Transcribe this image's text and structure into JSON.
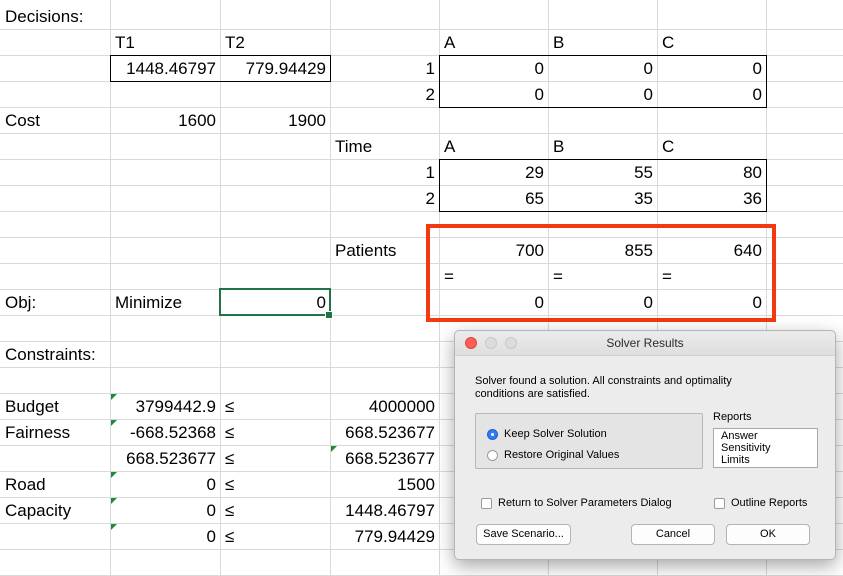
{
  "sheet": {
    "decisions_label": "Decisions:",
    "col_T1": "T1",
    "col_T2": "T2",
    "t1_value": "1448.46797",
    "t2_value": "779.94429",
    "grid_header": {
      "A": "A",
      "B": "B",
      "C": "C"
    },
    "row1": "1",
    "row2": "2",
    "dec_row1": [
      "0",
      "0",
      "0"
    ],
    "dec_row2": [
      "0",
      "0",
      "0"
    ],
    "cost_label": "Cost",
    "cost_t1": "1600",
    "cost_t2": "1900",
    "time_label": "Time",
    "time_row1": [
      "29",
      "55",
      "80"
    ],
    "time_row2": [
      "65",
      "35",
      "36"
    ],
    "patients_label": "Patients",
    "patients": [
      "700",
      "855",
      "640"
    ],
    "equals": [
      "=",
      "=",
      "="
    ],
    "patients_result": [
      "0",
      "0",
      "0"
    ],
    "obj_label": "Obj:",
    "minimize_label": "Minimize",
    "obj_value": "0",
    "constraints_label": "Constraints:",
    "constraints": [
      {
        "name": "Budget",
        "lhs": "3799442.9",
        "op": "≤",
        "rhs": "4000000"
      },
      {
        "name": "Fairness",
        "lhs": "-668.52368",
        "op": "≤",
        "rhs": "668.523677"
      },
      {
        "name": "",
        "lhs": "668.523677",
        "op": "≤",
        "rhs": "668.523677"
      },
      {
        "name": "Road",
        "lhs": "0",
        "op": "≤",
        "rhs": "1500"
      },
      {
        "name": "Capacity",
        "lhs": "0",
        "op": "≤",
        "rhs": "1448.46797"
      },
      {
        "name": "",
        "lhs": "0",
        "op": "≤",
        "rhs": "779.94429"
      }
    ]
  },
  "dialog": {
    "title": "Solver Results",
    "message_line1": "Solver found a solution.  All constraints and optimality",
    "message_line2": "conditions are satisfied.",
    "keep_label": "Keep Solver Solution",
    "restore_label": "Restore Original Values",
    "selected_option": "keep",
    "reports_label": "Reports",
    "reports": [
      "Answer",
      "Sensitivity",
      "Limits"
    ],
    "return_label": "Return to Solver Parameters Dialog",
    "outline_label": "Outline Reports",
    "save_label": "Save Scenario...",
    "cancel_label": "Cancel",
    "ok_label": "OK"
  },
  "colors": {
    "highlight": "#f2390f",
    "selection": "#217346",
    "radio": "#2d7bf6"
  }
}
